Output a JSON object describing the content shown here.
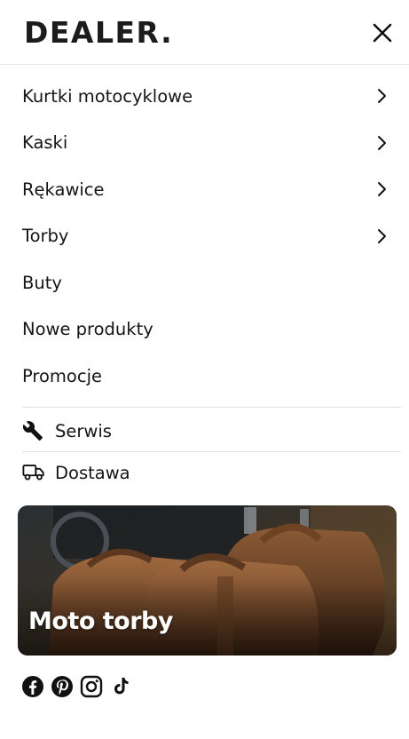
{
  "header": {
    "logo_text": "DEALER.",
    "close_icon": "close-icon"
  },
  "menu": {
    "items": [
      {
        "label": "Kurtki motocyklowe",
        "has_submenu": true
      },
      {
        "label": "Kaski",
        "has_submenu": true
      },
      {
        "label": "Rękawice",
        "has_submenu": true
      },
      {
        "label": "Torby",
        "has_submenu": true
      },
      {
        "label": "Buty",
        "has_submenu": false
      },
      {
        "label": "Nowe produkty",
        "has_submenu": false
      },
      {
        "label": "Promocje",
        "has_submenu": false
      }
    ]
  },
  "utility": {
    "items": [
      {
        "label": "Serwis",
        "icon": "wrench-icon"
      },
      {
        "label": "Dostawa",
        "icon": "truck-icon"
      }
    ]
  },
  "banner": {
    "title": "Moto torby"
  },
  "social": {
    "icons": [
      "facebook-icon",
      "pinterest-icon",
      "instagram-icon",
      "tiktok-icon"
    ]
  },
  "colors": {
    "text": "#151515",
    "divider": "#e3e3e3",
    "background": "#ffffff"
  }
}
